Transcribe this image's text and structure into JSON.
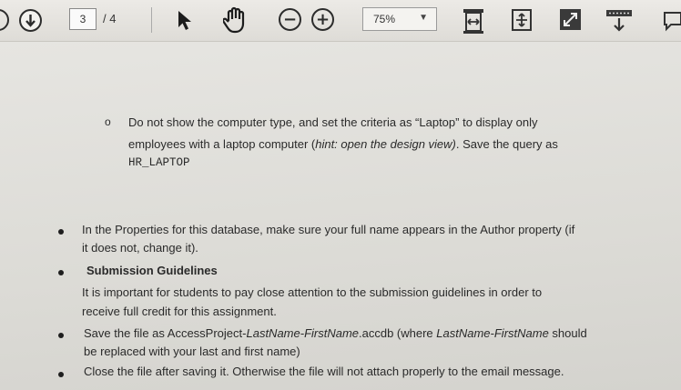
{
  "toolbar": {
    "page_current": "3",
    "page_total": "/ 4",
    "zoom": "75%",
    "icons": [
      "scroll-down-icon",
      "hand-tool-icon",
      "zoom-out-icon",
      "zoom-in-icon",
      "fit-width-icon",
      "fit-page-icon",
      "fullscreen-icon",
      "read-mode-icon"
    ]
  },
  "document": {
    "sub_item": {
      "marker": "o",
      "line1": "Do not show the computer type, and set the criteria as “Laptop” to display only",
      "line2_a": "employees with a laptop computer (",
      "line2_hint": "hint: open the design view)",
      "line2_b": ". Save the query as",
      "line3": "HR_LAPTOP"
    },
    "bullets": [
      {
        "line1": "In the Properties for this database, make sure your full name appears in the Author property (if",
        "line2": "it does not, change it)."
      },
      {
        "title": "Submission Guidelines",
        "body1": "It is important for students to pay close attention to the submission guidelines in order to",
        "body2": "receive full credit for this assignment."
      },
      {
        "line1_a": "Save the file as AccessProject-",
        "line1_italic": "LastName-FirstName",
        "line1_b": ".accdb (where ",
        "line1_italic2": "LastName-FirstName",
        "line1_c": " should",
        "line2": "be replaced with your last and first name)"
      },
      {
        "line1": "Close the file after saving it. Otherwise the file will not attach properly to the email message."
      }
    ]
  }
}
